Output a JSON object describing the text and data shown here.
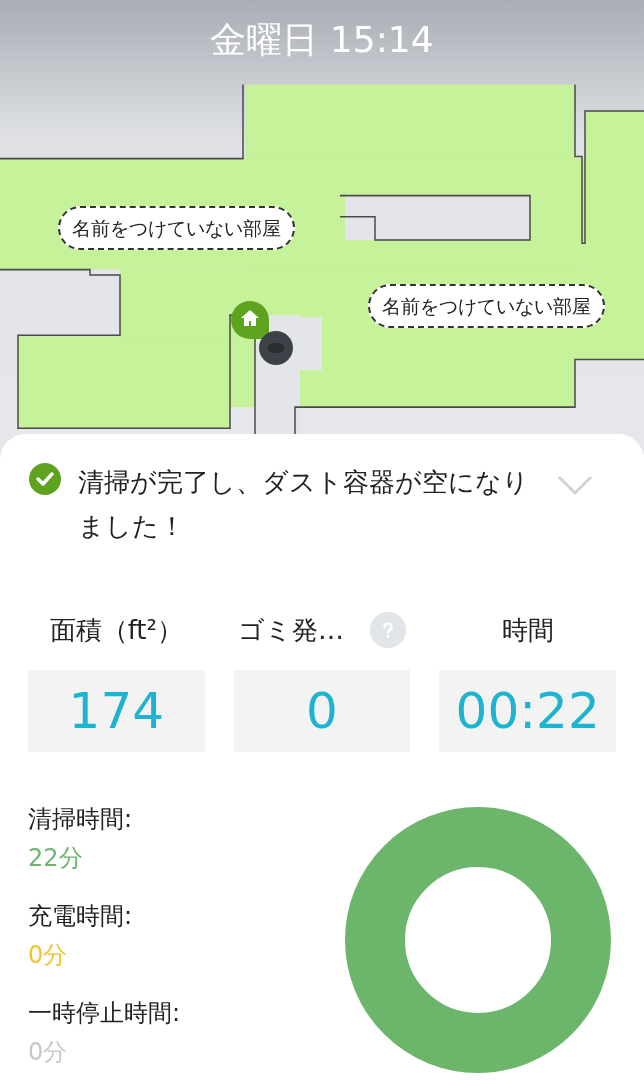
{
  "header": {
    "title": "金曜日 15:14"
  },
  "map": {
    "room_labels": [
      "名前をつけていない部屋",
      "名前をつけていない部屋"
    ]
  },
  "status": {
    "message": "清掃が完了し、ダスト容器が空になりました！",
    "completed": true
  },
  "stats": [
    {
      "label": "面積（ft²）",
      "value": "174",
      "help": false
    },
    {
      "label": "ゴミ発…",
      "value": "0",
      "help": true
    },
    {
      "label": "時間",
      "value": "00:22",
      "help": false
    }
  ],
  "breakdown": [
    {
      "label": "清掃時間:",
      "value": "22分",
      "color": "#6cb66b"
    },
    {
      "label": "充電時間:",
      "value": "0分",
      "color": "#f2c233"
    },
    {
      "label": "一時停止時間:",
      "value": "0分",
      "color": "#c8c8c8"
    }
  ]
}
